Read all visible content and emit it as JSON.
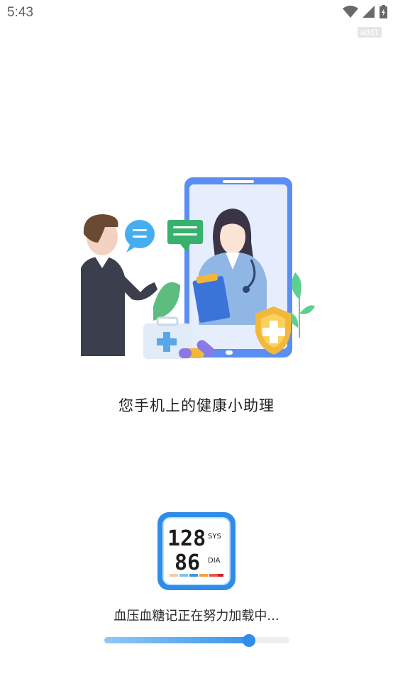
{
  "status_bar": {
    "time": "5:43",
    "icons": [
      "wifi-icon",
      "signal-icon",
      "battery-charging-icon"
    ]
  },
  "badge": {
    "label": "addl"
  },
  "illustration": {
    "icon": "doctor-consultation-illustration"
  },
  "tagline": "您手机上的健康小助理",
  "app_logo": {
    "icon": "blood-pressure-monitor-icon",
    "sys_value": "128",
    "sys_label": "SYS",
    "dia_value": "86",
    "dia_label": "DIA",
    "accent": "#2f8ce9"
  },
  "loading": {
    "text": "血压血糖记正在努力加载中...",
    "progress": 0.78
  }
}
